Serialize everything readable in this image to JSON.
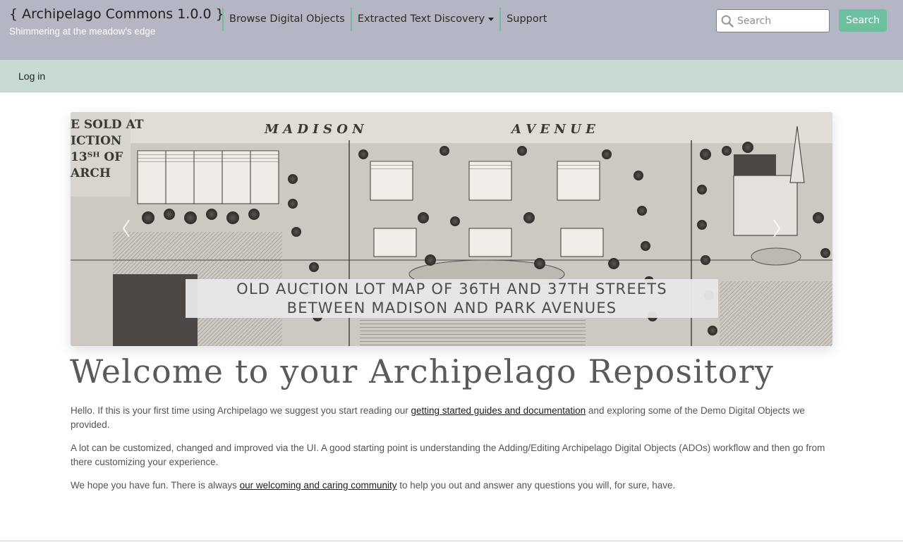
{
  "header": {
    "site_name": "{ Archipelago Commons 1.0.0 }",
    "slogan": "Shimmering at the meadow's edge",
    "nav": [
      {
        "label": "Browse Digital Objects"
      },
      {
        "label": "Extracted Text Discovery",
        "has_dropdown": true
      },
      {
        "label": "Support"
      }
    ],
    "search": {
      "placeholder": "Search",
      "value": "",
      "icon": "search-icon",
      "button_label": "Search"
    }
  },
  "subnav": {
    "login_label": "Log in"
  },
  "carousel": {
    "image": "old auction lot map engraving",
    "map_lettering": [
      "M A D I S O N",
      "A V E N U E",
      "E SOLD AT",
      "ICTION",
      "13ᵀᴴ OF",
      "ARCH"
    ],
    "caption_line1": "OLD AUCTION LOT MAP OF 36TH AND 37TH STREETS",
    "caption_line2": "BETWEEN MADISON AND PARK AVENUES",
    "prev_icon": "chevron-left-icon",
    "next_icon": "chevron-right-icon"
  },
  "main": {
    "title": "Welcome to your Archipelago Repository",
    "p1": {
      "before": "Hello. If this is your first time using Archipelago we suggest you start reading our ",
      "link": "getting started guides and documentation",
      "after": " and exploring some of the Demo Digital Objects we provided."
    },
    "p2": "A lot can be customized, changed and improved via the UI. A good starting point is understanding the Adding/Editing Archipelago Digital Objects (ADOs) workflow and then go from there customizing your experience.",
    "p3": {
      "before": "We hope you have fun. There is always ",
      "link": "our welcoming and caring community",
      "after": " to help you out and answer any questions you will, for sure, have."
    }
  },
  "colors": {
    "header_bg": "#b4b6c4",
    "subnav_bg": "#c7dbd3",
    "accent": "#6cbf9f"
  }
}
